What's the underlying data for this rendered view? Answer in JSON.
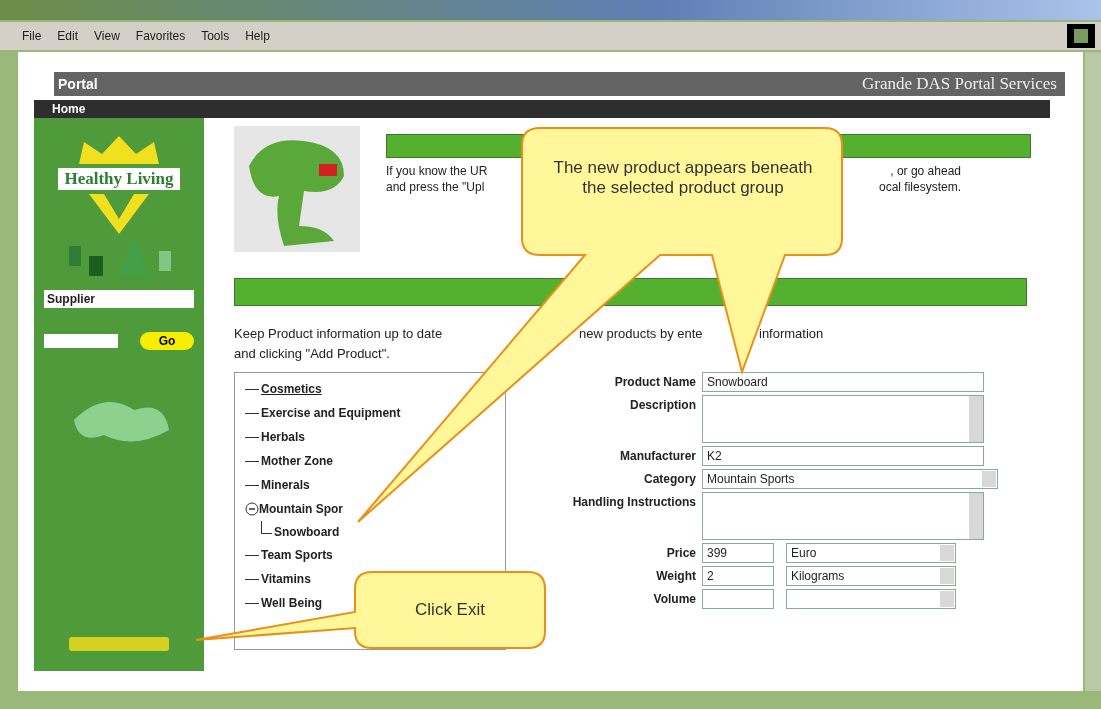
{
  "browser": {
    "menu": [
      "File",
      "Edit",
      "View",
      "Favorites",
      "Tools",
      "Help"
    ]
  },
  "header": {
    "title": "Portal",
    "brand": "Grande DAS Portal Services"
  },
  "nav": {
    "label": "Home"
  },
  "sidebar": {
    "logo": "Healthy Living",
    "search": {
      "value": "Supplier"
    },
    "go_button": "Go"
  },
  "intro": {
    "lines": [
      [
        "If you know the UR",
        ", or go ahead"
      ],
      [
        "and press the \"Upl",
        "ocal filesystem."
      ]
    ]
  },
  "products": {
    "lines": [
      [
        "Keep Product information up to date",
        "new products by ente",
        "information"
      ],
      [
        "and clicking \"Add Product\"."
      ]
    ],
    "tree": [
      {
        "label": "Cosmetics",
        "expanded": false
      },
      {
        "label": "Exercise and Equipment",
        "expanded": false
      },
      {
        "label": "Herbals",
        "expanded": false
      },
      {
        "label": "Mother Zone",
        "expanded": false
      },
      {
        "label": "Minerals",
        "expanded": false
      },
      {
        "label": "Mountain Spor",
        "expanded": true,
        "children": [
          {
            "label": "Snowboard"
          }
        ]
      },
      {
        "label": "Team Sports",
        "expanded": false
      },
      {
        "label": "Vitamins",
        "expanded": false
      },
      {
        "label": "Well Being",
        "expanded": false
      }
    ],
    "form": [
      {
        "kind": "text",
        "label": "Product Name",
        "value": "Snowboard"
      },
      {
        "kind": "textarea",
        "label": "Description"
      },
      {
        "kind": "text",
        "label": "Manufacturer",
        "value": "K2"
      },
      {
        "kind": "select",
        "label": "Category",
        "value": "Mountain Sports"
      },
      {
        "kind": "textarea",
        "label": "Handling Instructions"
      },
      {
        "kind": "pair",
        "label": "Price",
        "value": "399",
        "unit": "Euro"
      },
      {
        "kind": "pair",
        "label": "Weight",
        "value": "2",
        "unit": "Kilograms"
      },
      {
        "kind": "pair",
        "label": "Volume"
      }
    ]
  },
  "callouts": [
    {
      "text": "The new product appears beneath the selected product group"
    },
    {
      "text": "Click Exit"
    }
  ]
}
